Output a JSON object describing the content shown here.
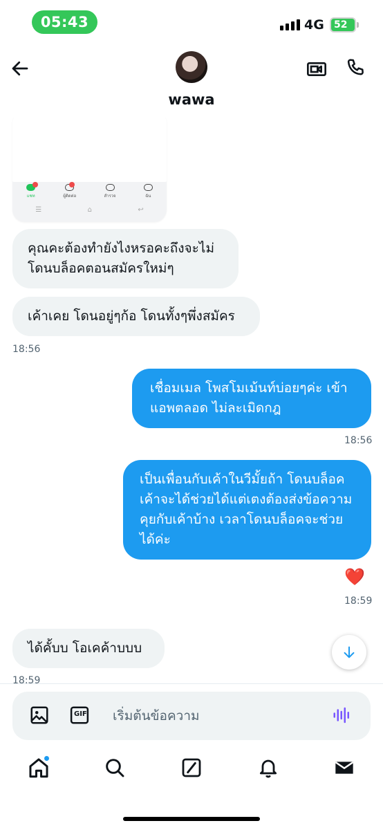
{
  "status_bar": {
    "time": "05:43",
    "network": "4G",
    "battery": "52"
  },
  "header": {
    "contact_name": "wawa"
  },
  "embedded_screenshot": {
    "tabs": [
      "แชท",
      "ผู้ติดต่อ",
      "สำรวจ",
      "ฉัน"
    ]
  },
  "messages": [
    {
      "direction": "in",
      "text": "คุณคะต้องทำยังไงหรอคะถึงจะไม่โดนบล็อคตอนสมัครใหม่ๆ"
    },
    {
      "direction": "in",
      "text": "เค้าเคย โดนอยู่ๆก้อ โดนทั้งๆพึ่งสมัคร",
      "timestamp": "18:56"
    },
    {
      "direction": "out",
      "text": "เชื่อมเมล โพสโมเม้นท์บ่อยๆค่ะ เข้าแอพตลอด ไม่ละเมิดกฎ",
      "timestamp": "18:56"
    },
    {
      "direction": "out",
      "text": "เป็นเพื่อนกับเค้าในวีมั้ยถ้า โดนบล็อคเค้าจะได้ช่วยได้แต่เตงต้องส่งข้อความคุยกับเค้าบ้าง เวลาโดนบล็อคจะช่วยได้ค่ะ",
      "reaction": "❤️",
      "timestamp": "18:59"
    },
    {
      "direction": "in",
      "text": "ได้คั้บบ โอเคค้าบบบ",
      "timestamp": "18:59"
    }
  ],
  "composer": {
    "placeholder": "เริ่มต้นข้อความ",
    "gif_label": "GIF"
  },
  "colors": {
    "accent": "#1d9bf0",
    "incoming_bubble": "#eff3f4",
    "status_green": "#34c759"
  }
}
